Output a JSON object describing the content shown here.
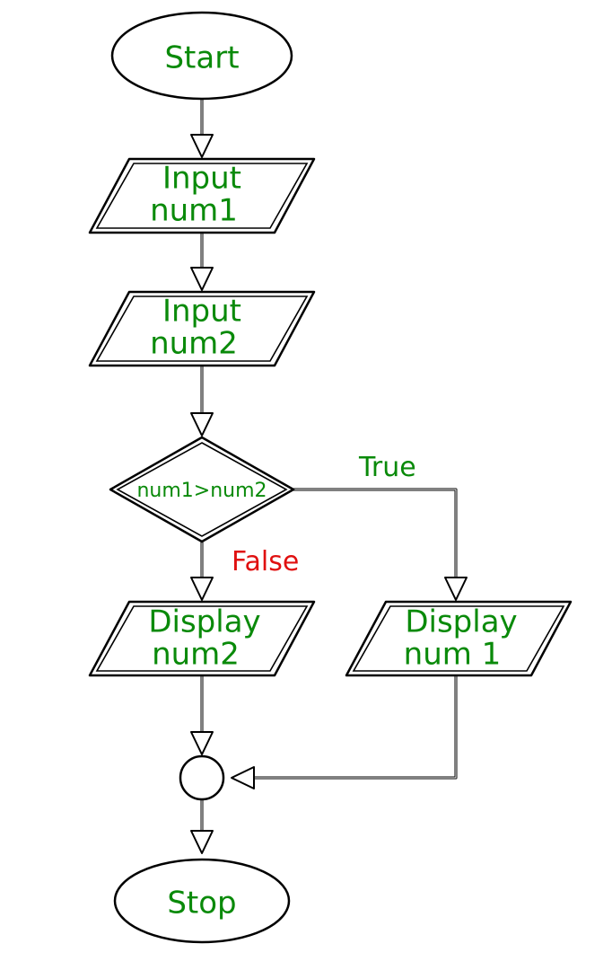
{
  "nodes": {
    "start": {
      "label": "Start"
    },
    "input1": {
      "line1": "Input",
      "line2": "num1"
    },
    "input2": {
      "line1": "Input",
      "line2": "num2"
    },
    "decision": {
      "label": "num1>num2"
    },
    "display_false": {
      "line1": "Display",
      "line2": "num2"
    },
    "display_true": {
      "line1": "Display",
      "line2": "num 1"
    },
    "stop": {
      "label": "Stop"
    }
  },
  "branches": {
    "true": "True",
    "false": "False"
  }
}
